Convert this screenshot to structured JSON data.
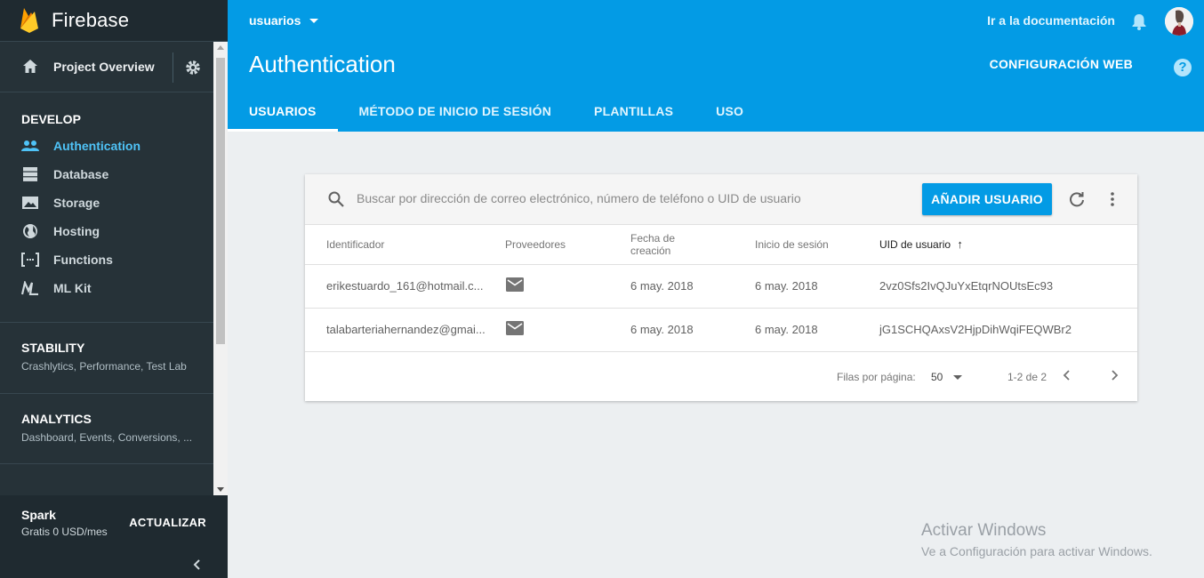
{
  "brand": {
    "name": "Firebase"
  },
  "sidebar": {
    "overview_label": "Project Overview",
    "develop_title": "DEVELOP",
    "items": [
      {
        "label": "Authentication",
        "icon": "people-icon"
      },
      {
        "label": "Database",
        "icon": "database-icon"
      },
      {
        "label": "Storage",
        "icon": "storage-icon"
      },
      {
        "label": "Hosting",
        "icon": "globe-icon"
      },
      {
        "label": "Functions",
        "icon": "functions-icon"
      },
      {
        "label": "ML Kit",
        "icon": "ml-kit-icon"
      }
    ],
    "groups": [
      {
        "title": "STABILITY",
        "subtitle": "Crashlytics, Performance, Test Lab"
      },
      {
        "title": "ANALYTICS",
        "subtitle": "Dashboard, Events, Conversions, ..."
      }
    ],
    "plan": {
      "name": "Spark",
      "price": "Gratis 0 USD/mes",
      "upgrade_label": "ACTUALIZAR"
    }
  },
  "header": {
    "project": "usuarios",
    "docs_link": "Ir a la documentación",
    "title": "Authentication",
    "web_config": "CONFIGURACIÓN WEB",
    "help": "?",
    "tabs": [
      "USUARIOS",
      "MÉTODO DE INICIO DE SESIÓN",
      "PLANTILLAS",
      "USO"
    ],
    "accent_color": "#039be5"
  },
  "users_table": {
    "search_placeholder": "Buscar por dirección de correo electrónico, número de teléfono o UID de usuario",
    "add_user_label": "AÑADIR USUARIO",
    "columns": [
      "Identificador",
      "Proveedores",
      "Fecha de creación",
      "Inicio de sesión",
      "UID de usuario"
    ],
    "sort_indicator": "↑",
    "rows": [
      {
        "identifier": "erikestuardo_161@hotmail.c...",
        "provider": "email-icon",
        "created": "6 may. 2018",
        "signed_in": "6 may. 2018",
        "uid": "2vz0Sfs2IvQJuYxEtqrNOUtsEc93"
      },
      {
        "identifier": "talabarteriahernandez@gmai...",
        "provider": "email-icon",
        "created": "6 may. 2018",
        "signed_in": "6 may. 2018",
        "uid": "jG1SCHQAxsV2HjpDihWqiFEQWBr2"
      }
    ],
    "rows_per_page_label": "Filas por página:",
    "rows_per_page": "50",
    "range": "1-2 de 2"
  },
  "watermark": {
    "line1": "Activar Windows",
    "line2": "Ve a Configuración para activar Windows."
  }
}
